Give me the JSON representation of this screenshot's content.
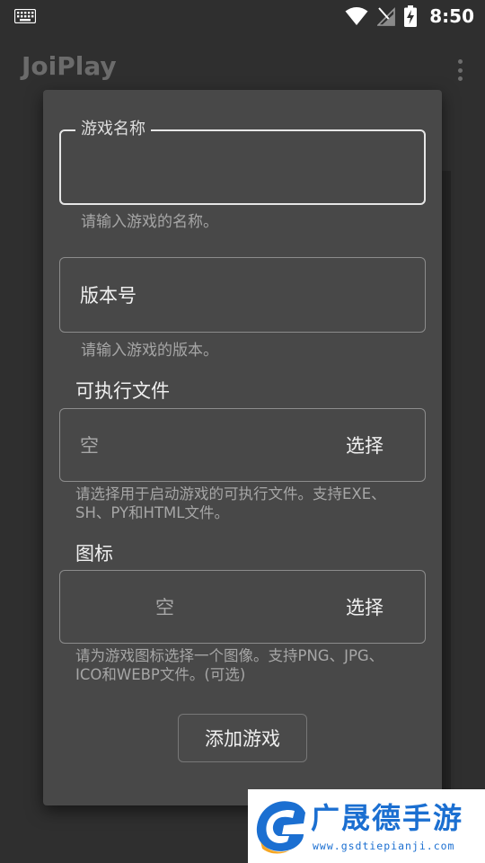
{
  "status_bar": {
    "time": "8:50",
    "icons": [
      "keyboard-icon",
      "wifi-icon",
      "no-signal-icon",
      "battery-charging-icon"
    ]
  },
  "app_bar": {
    "title": "JoiPlay",
    "overflow_icon": "more-vert-icon"
  },
  "dialog": {
    "game_name": {
      "label": "游戏名称",
      "value": "",
      "helper": "请输入游戏的名称。"
    },
    "version": {
      "label": "版本号",
      "value": "",
      "helper": "请输入游戏的版本。"
    },
    "executable": {
      "label": "可执行文件",
      "value": "空",
      "button": "选择",
      "helper": "请选择用于启动游戏的可执行文件。支持EXE、SH、PY和HTML文件。"
    },
    "icon": {
      "label": "图标",
      "value": "空",
      "button": "选择",
      "helper": "请为游戏图标选择一个图像。支持PNG、JPG、ICO和WEBP文件。(可选)"
    },
    "add_button": "添加游戏"
  },
  "watermark": {
    "title": "广晟德手游",
    "url": "www.gsdtiepianji.com"
  },
  "colors": {
    "background": "#2f2f2f",
    "dialog": "#484848",
    "accent_text": "#f0f0f0",
    "helper_text": "#a6a6a6",
    "watermark_blue": "#1b6fd1"
  }
}
